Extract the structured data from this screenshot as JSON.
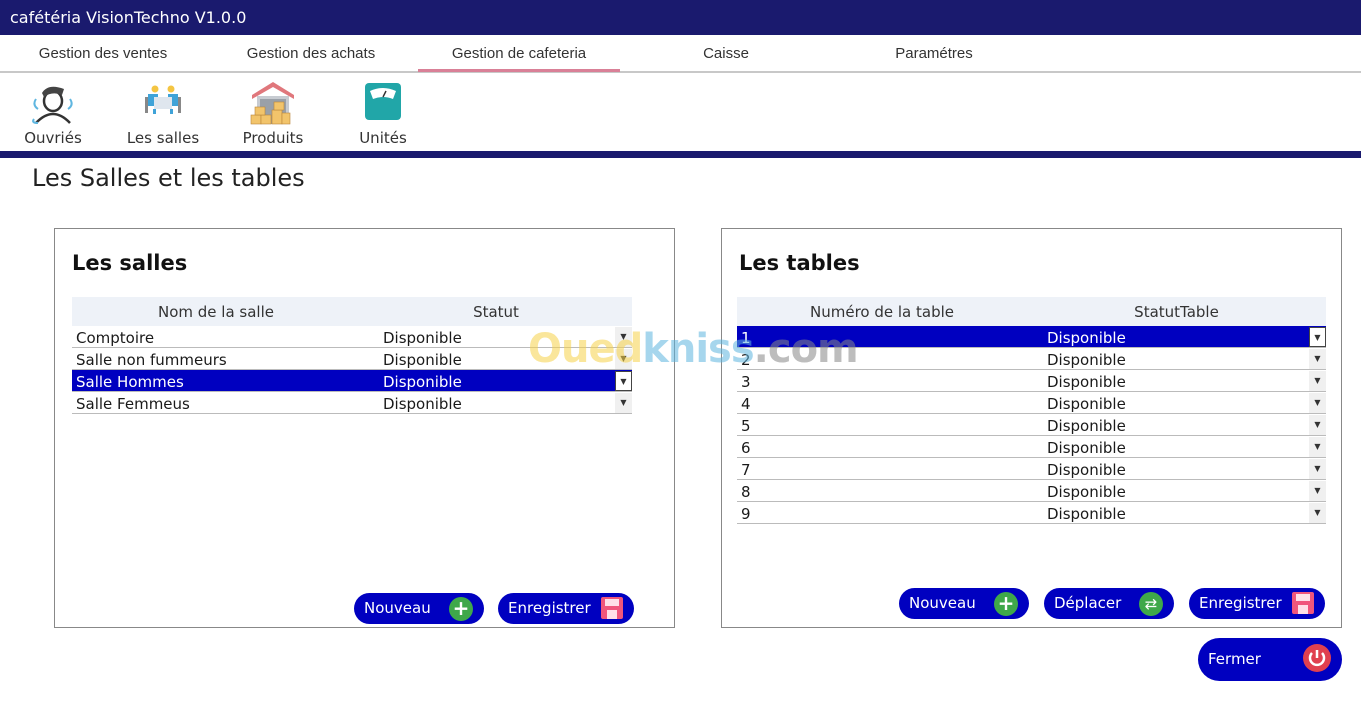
{
  "app": {
    "title": "cafétéria VisionTechno V1.0.0"
  },
  "tabs": [
    {
      "label": "Gestion des ventes",
      "active": false
    },
    {
      "label": "Gestion des achats",
      "active": false
    },
    {
      "label": "Gestion de cafeteria",
      "active": true
    },
    {
      "label": "Caisse",
      "active": false
    },
    {
      "label": "Paramétres",
      "active": false
    }
  ],
  "ribbon": [
    {
      "label": "Ouvriés",
      "icon": "worker-icon"
    },
    {
      "label": "Les salles",
      "icon": "meeting-room-icon"
    },
    {
      "label": "Produits",
      "icon": "warehouse-icon"
    },
    {
      "label": "Unités",
      "icon": "scale-icon"
    }
  ],
  "page": {
    "title": "Les Salles et les tables"
  },
  "salles": {
    "title": "Les salles",
    "columns": [
      "Nom de la salle",
      "Statut"
    ],
    "rows": [
      {
        "name": "Comptoire",
        "status": "Disponible",
        "selected": false
      },
      {
        "name": "Salle non fummeurs",
        "status": "Disponible",
        "selected": false
      },
      {
        "name": "Salle Hommes",
        "status": "Disponible",
        "selected": true
      },
      {
        "name": "Salle Femmeus",
        "status": "Disponible",
        "selected": false
      }
    ],
    "buttons": {
      "new": "Nouveau",
      "save": "Enregistrer"
    }
  },
  "tables": {
    "title": "Les tables",
    "columns": [
      "Numéro de la table",
      "StatutTable"
    ],
    "rows": [
      {
        "number": "1",
        "status": "Disponible",
        "selected": true
      },
      {
        "number": "2",
        "status": "Disponible",
        "selected": false
      },
      {
        "number": "3",
        "status": "Disponible",
        "selected": false
      },
      {
        "number": "4",
        "status": "Disponible",
        "selected": false
      },
      {
        "number": "5",
        "status": "Disponible",
        "selected": false
      },
      {
        "number": "6",
        "status": "Disponible",
        "selected": false
      },
      {
        "number": "7",
        "status": "Disponible",
        "selected": false
      },
      {
        "number": "8",
        "status": "Disponible",
        "selected": false
      },
      {
        "number": "9",
        "status": "Disponible",
        "selected": false
      }
    ],
    "buttons": {
      "new": "Nouveau",
      "move": "Déplacer",
      "save": "Enregistrer"
    }
  },
  "close_button": "Fermer",
  "watermark": {
    "part1": "Oued",
    "part2": "kniss",
    "part3": ".com"
  },
  "colors": {
    "titlebar": "#1a1a6e",
    "accent": "#0000c0",
    "tab_underline": "#d98097",
    "green": "#3fa84a",
    "red": "#e0404f"
  }
}
